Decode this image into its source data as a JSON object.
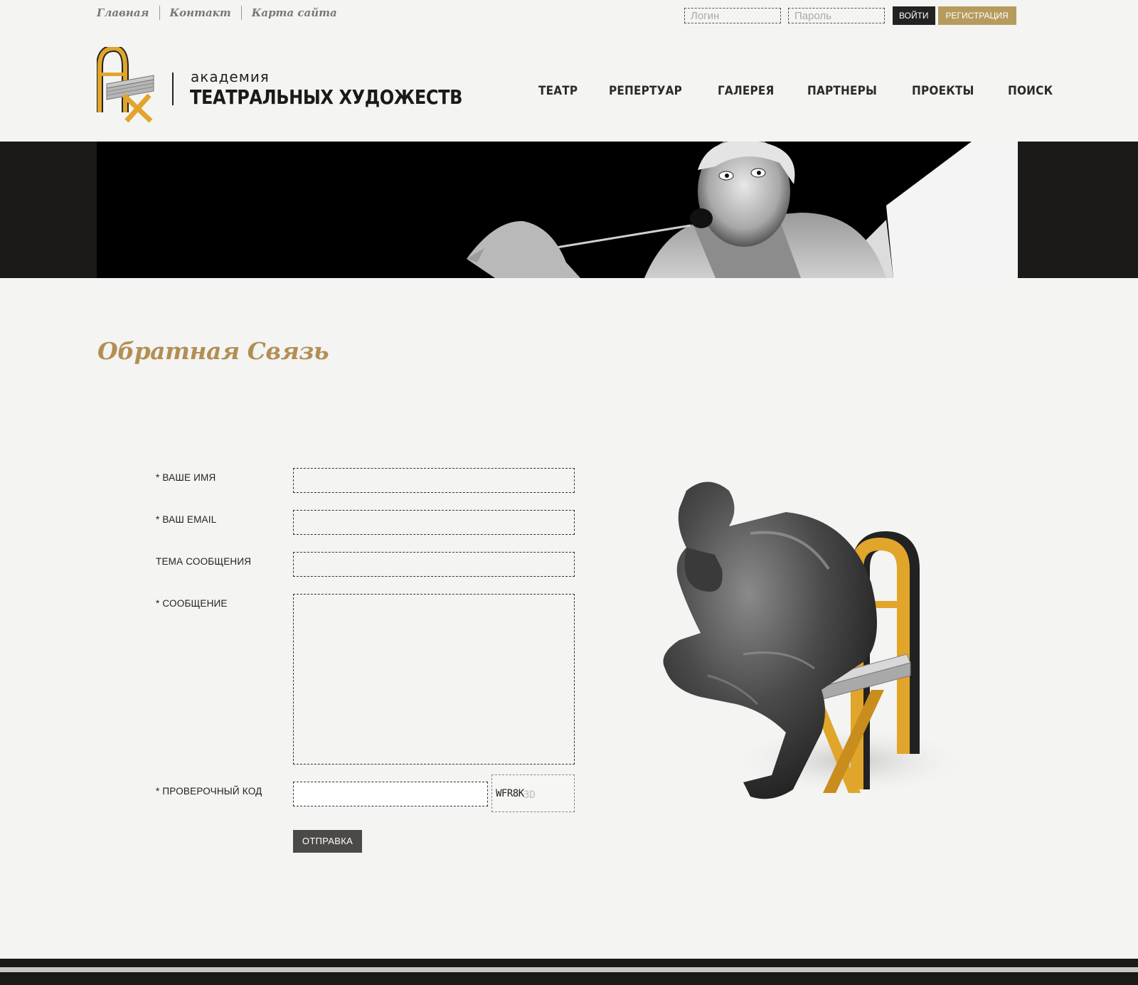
{
  "top_links": [
    "Главная",
    "Контакт",
    "Карта сайта"
  ],
  "auth": {
    "login_placeholder": "Логин",
    "password_placeholder": "Пароль",
    "login_button": "ВОЙТИ",
    "register_button": "РЕГИСТРАЦИЯ"
  },
  "logo": {
    "small": "академия",
    "big": "ТЕАТРАЛЬНЫХ ХУДОЖЕСТВ"
  },
  "nav": [
    "ТЕАТР",
    "РЕПЕРТУАР",
    "ГАЛЕРЕЯ",
    "ПАРТНЕРЫ",
    "ПРОЕКТЫ",
    "ПОИСК"
  ],
  "page_title": "Обратная Связь",
  "form": {
    "name_label": "* ВАШЕ ИМЯ",
    "email_label": "* ВАШ EMAIL",
    "subject_label": "ТЕМА СООБЩЕНИЯ",
    "message_label": "* СООБЩЕНИЕ",
    "captcha_label": "* ПРОВЕРОЧНЫЙ КОД",
    "captcha_code": "WFR8K",
    "captcha_ghost": "3D",
    "submit": "ОТПРАВКА"
  },
  "colors": {
    "accent_gold": "#b69b5e",
    "title_gold": "#b38f55",
    "chair_yellow": "#e0a52a",
    "dark": "#222222"
  }
}
